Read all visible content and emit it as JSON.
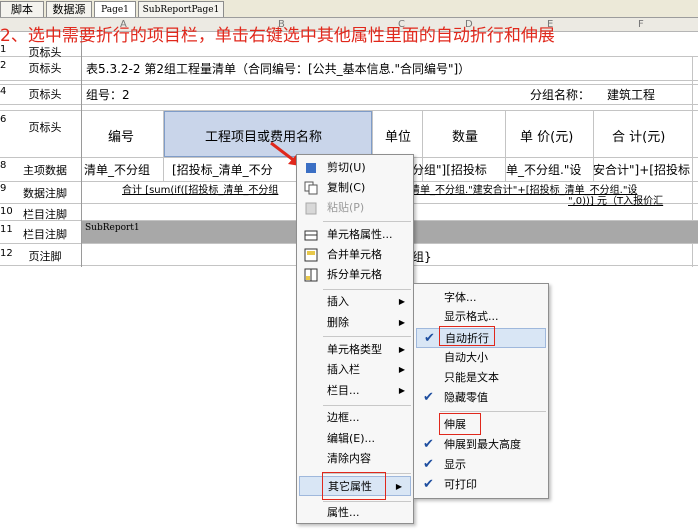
{
  "tabs": [
    {
      "label": "脚本",
      "active": false
    },
    {
      "label": "数据源",
      "active": false
    },
    {
      "label": "Page1",
      "active": true
    },
    {
      "label": "SubReportPage1",
      "active": false
    }
  ],
  "column_letters": [
    "A",
    "B",
    "C",
    "D",
    "E",
    "F"
  ],
  "instruction_overlay": "2、选中需要折行的项目栏，单击右键选中其他属性里面的自动折行和伸展",
  "rows": [
    {
      "num": "1",
      "label": "页标头"
    },
    {
      "num": "2",
      "label": "页标头"
    },
    {
      "num": "4",
      "label": "页标头"
    },
    {
      "num": "6",
      "label": "页标头"
    },
    {
      "num": "8",
      "label": "主项数据"
    },
    {
      "num": "9",
      "label": "数据注脚"
    },
    {
      "num": "10",
      "label": "栏目注脚"
    },
    {
      "num": "11",
      "label": "栏目注脚"
    },
    {
      "num": "12",
      "label": "页注脚"
    }
  ],
  "cells": {
    "row2_title": "表5.3.2-2 第2组工程量清单（合同编号：[公共_基本信息.\"合同编号\"]）",
    "row4_group": "组号：2",
    "row4_group_name_label": "分组名称：",
    "row4_group_name_value": "建筑工程",
    "h_code": "编号",
    "h_item": "工程项目或费用名称",
    "h_unit": "单位",
    "h_qty": "数量",
    "h_price": "单 价(元)",
    "h_total": "合 计(元)",
    "r8_a": "清单_不分组",
    "r8_b": "[招投标_清单_不分",
    "r8_c": "分组\"][招投标",
    "r8_d": "单_不分组.\"设",
    "r8_e": "安合计\"]+[招投标",
    "r9_text": "合计 [sum(if([招投标_清单_不分组",
    "r9_text2": "清单_不分组.\"建安合计\"+[招投标_清单_不分组.\"设",
    "r10_text": "\",0))] 元（T入报价汇",
    "r11_sub": "SubReport1",
    "r12_text": "组}"
  },
  "context_menu": {
    "items": [
      {
        "label": "剪切(U)",
        "icon": "cut-icon",
        "disabled": false
      },
      {
        "label": "复制(C)",
        "icon": "copy-icon",
        "disabled": false
      },
      {
        "label": "粘贴(P)",
        "icon": "paste-icon",
        "disabled": true
      },
      {
        "label": "单元格属性...",
        "icon": "cell-properties-icon",
        "disabled": false
      },
      {
        "label": "合并单元格",
        "icon": "merge-cells-icon",
        "disabled": false
      },
      {
        "label": "拆分单元格",
        "icon": "split-cells-icon",
        "disabled": false
      },
      {
        "label": "插入",
        "submenu": true
      },
      {
        "label": "删除",
        "submenu": true
      },
      {
        "label": "单元格类型",
        "submenu": true
      },
      {
        "label": "插入栏",
        "submenu": true
      },
      {
        "label": "栏目...",
        "submenu": true
      },
      {
        "label": "边框..."
      },
      {
        "label": "编辑(E)..."
      },
      {
        "label": "清除内容"
      },
      {
        "label": "其它属性",
        "submenu": true,
        "highlighted": true
      },
      {
        "label": "属性..."
      }
    ]
  },
  "submenu": {
    "items": [
      {
        "label": "字体...",
        "checked": false
      },
      {
        "label": "显示格式...",
        "checked": false
      },
      {
        "label": "自动折行",
        "checked": true,
        "highlighted": true
      },
      {
        "label": "自动大小",
        "checked": false
      },
      {
        "label": "只能是文本",
        "checked": false
      },
      {
        "label": "隐藏零值",
        "checked": true
      },
      {
        "label": "伸展",
        "checked": false
      },
      {
        "label": "伸展到最大高度",
        "checked": true
      },
      {
        "label": "显示",
        "checked": true
      },
      {
        "label": "可打印",
        "checked": true
      }
    ]
  },
  "colors": {
    "annotation_red": "#e0281c",
    "selected_cell": "#c9d5ea",
    "check_blue": "#1f4fa0"
  }
}
